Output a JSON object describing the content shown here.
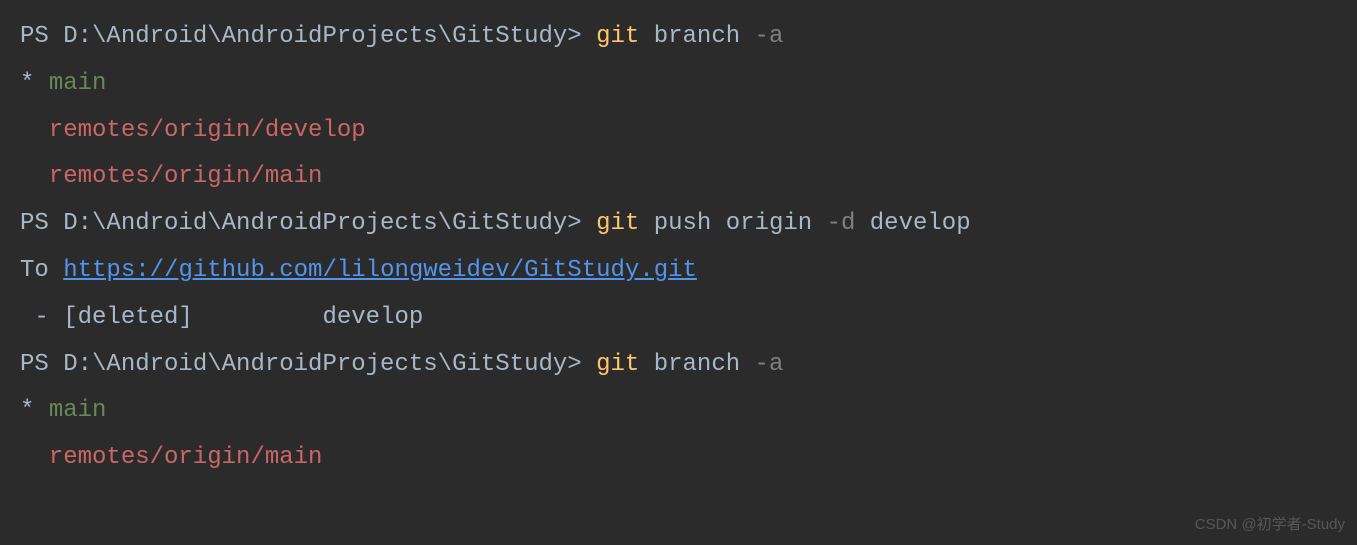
{
  "prompt": "PS D:\\Android\\AndroidProjects\\GitStudy> ",
  "cmd1": {
    "git": "git",
    "sub": "branch",
    "flag": "-a"
  },
  "branches1": {
    "asterisk": "*",
    "current": "main",
    "remote1": "remotes/origin/develop",
    "remote2": "remotes/origin/main"
  },
  "cmd2": {
    "git": "git",
    "sub": "push origin",
    "flag": "-d",
    "arg": "develop"
  },
  "push_output": {
    "to": "To ",
    "url": "https://github.com/lilongweidev/GitStudy.git",
    "deleted_prefix": " - [deleted]         ",
    "deleted_branch": "develop"
  },
  "cmd3": {
    "git": "git",
    "sub": "branch",
    "flag": "-a"
  },
  "branches2": {
    "asterisk": "*",
    "current": "main",
    "remote1": "remotes/origin/main"
  },
  "watermark": "CSDN @初学者-Study"
}
